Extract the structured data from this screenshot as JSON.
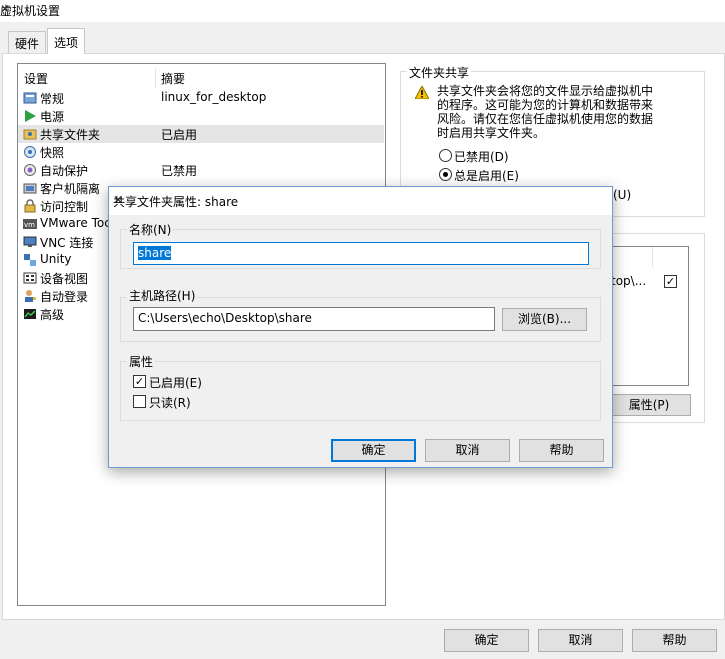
{
  "window": {
    "title": "虚拟机设置",
    "close_glyph": "✕"
  },
  "tabs": [
    {
      "label": "硬件"
    },
    {
      "label": "选项"
    }
  ],
  "list": {
    "col_setting": "设置",
    "col_summary": "摘要",
    "items": [
      {
        "name": "常规",
        "summary": "linux_for_desktop"
      },
      {
        "name": "电源",
        "summary": ""
      },
      {
        "name": "共享文件夹",
        "summary": "已启用"
      },
      {
        "name": "快照",
        "summary": ""
      },
      {
        "name": "自动保护",
        "summary": "已禁用"
      },
      {
        "name": "客户机隔离",
        "summary": ""
      },
      {
        "name": "访问控制",
        "summary": ""
      },
      {
        "name": "VMware Toc",
        "summary": ""
      },
      {
        "name": "VNC 连接",
        "summary": ""
      },
      {
        "name": "Unity",
        "summary": ""
      },
      {
        "name": "设备视图",
        "summary": ""
      },
      {
        "name": "自动登录",
        "summary": ""
      },
      {
        "name": "高级",
        "summary": ""
      }
    ]
  },
  "folder_sharing": {
    "group_label": "文件夹共享",
    "warning_lines": [
      "共享文件夹会将您的文件显示给虚拟机中",
      "的程序。这可能为您的计算机和数据带来",
      "风险。请仅在您信任虚拟机使用您的数据",
      "时启用共享文件夹。"
    ],
    "radio_disabled": "已禁用(D)",
    "radio_always": "总是启用(E)",
    "hidden_option_tail": "(U)"
  },
  "folders_panel": {
    "path_tail": "top\\...",
    "properties_button": "属性(P)"
  },
  "dialog": {
    "title": "共享文件夹属性: share",
    "close_glyph": "✕",
    "name_group": "名称(N)",
    "name_value": "share",
    "host_path_group": "主机路径(H)",
    "host_path_value": "C:\\Users\\echo\\Desktop\\share",
    "browse_button": "浏览(B)...",
    "attributes_group": "属性",
    "enabled_label": "已启用(E)",
    "readonly_label": "只读(R)",
    "ok_button": "确定",
    "cancel_button": "取消",
    "help_button": "帮助"
  },
  "footer": {
    "ok_button": "确定",
    "cancel_button": "取消",
    "help_button": "帮助"
  }
}
